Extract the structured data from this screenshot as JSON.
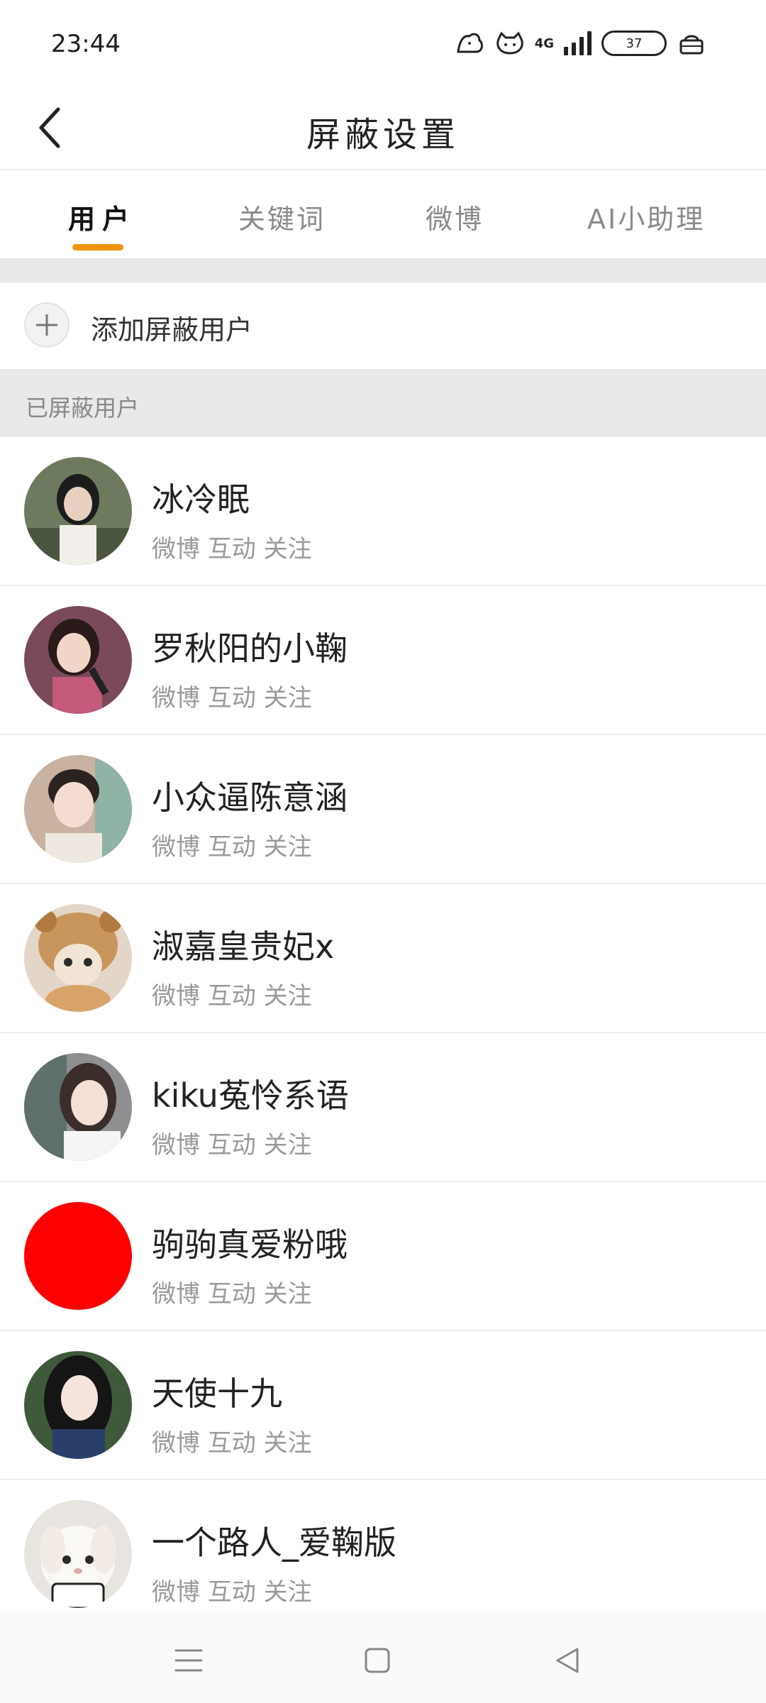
{
  "status_bar": {
    "time": "23:44",
    "network_label": "4G",
    "battery_level": "37"
  },
  "nav": {
    "title": "屏蔽设置"
  },
  "tabs": [
    {
      "label": "用户",
      "active": true
    },
    {
      "label": "关键词",
      "active": false
    },
    {
      "label": "微博",
      "active": false
    },
    {
      "label": "AI小助理",
      "active": false
    }
  ],
  "add_user": {
    "label": "添加屏蔽用户"
  },
  "section": {
    "label": "已屏蔽用户"
  },
  "users": [
    {
      "name": "冰冷眠",
      "meta": "微博 互动 关注",
      "avatar_color": "#6d7a5e"
    },
    {
      "name": "罗秋阳的小鞠",
      "meta": "微博 互动 关注",
      "avatar_color": "#7a4a5a"
    },
    {
      "name": "小众逼陈意涵",
      "meta": "微博 互动 关注",
      "avatar_color": "#c9b2a0"
    },
    {
      "name": "淑嘉皇贵妃x",
      "meta": "微博 互动 关注",
      "avatar_color": "#c8955c"
    },
    {
      "name": "kiku菟怜系语",
      "meta": "微博 互动 关注",
      "avatar_color": "#8f8f92"
    },
    {
      "name": "驹驹真爱粉哦",
      "meta": "微博 互动 关注",
      "avatar_color": "#ff0000"
    },
    {
      "name": "天使十九",
      "meta": "微博 互动 关注",
      "avatar_color": "#3e5a3a"
    },
    {
      "name": "一个路人_爱鞠版",
      "meta": "微博 互动 关注",
      "avatar_color": "#e8e4df"
    }
  ],
  "colors": {
    "accent": "#f0930a",
    "muted_text": "#9a9a9a",
    "section_bg": "#e9e9e9"
  },
  "icons": {
    "back": "chevron-left-icon",
    "add": "plus-icon",
    "menu": "menu-icon",
    "home": "home-square-icon",
    "nav_back": "triangle-back-icon"
  }
}
